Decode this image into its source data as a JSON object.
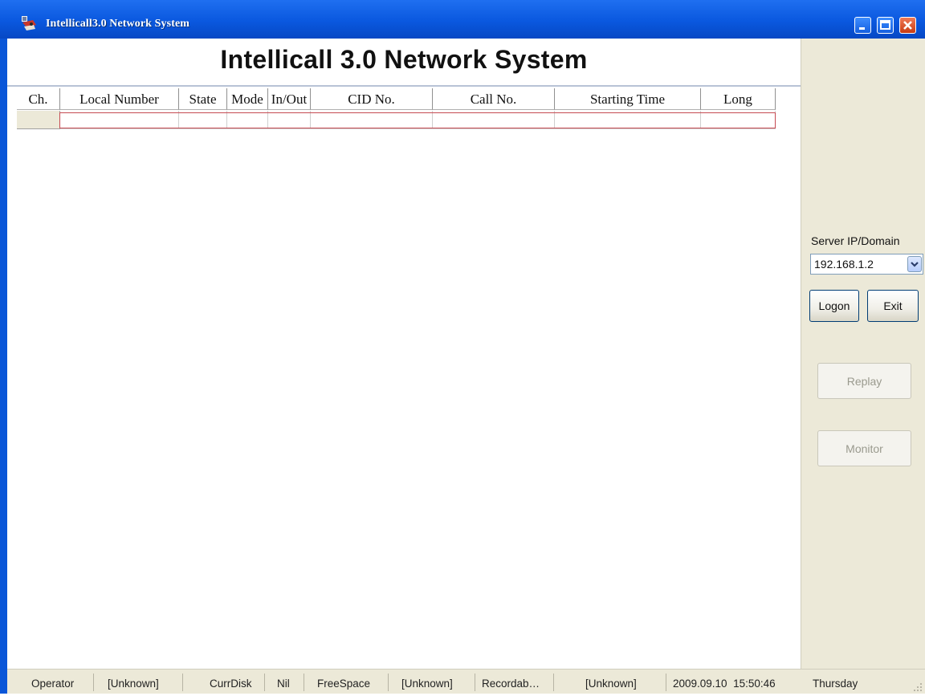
{
  "window": {
    "title": "Intellicall3.0 Network System",
    "icons": [
      "app-icon",
      "minimize-icon",
      "maximize-icon",
      "close-icon"
    ]
  },
  "header": {
    "title": "Intellicall 3.0 Network System"
  },
  "table": {
    "columns": [
      "Ch.",
      "Local Number",
      "State",
      "Mode",
      "In/Out",
      "CID No.",
      "Call No.",
      "Starting Time",
      "Long"
    ],
    "rows": [
      [
        "",
        "",
        "",
        "",
        "",
        "",
        "",
        "",
        ""
      ]
    ]
  },
  "side_panel": {
    "server_label": "Server IP/Domain",
    "server_value": "192.168.1.2",
    "logon_label": "Logon",
    "exit_label": "Exit",
    "replay_label": "Replay",
    "monitor_label": "Monitor"
  },
  "statusbar": {
    "operator_label": "Operator",
    "operator_value": "[Unknown]",
    "currdisk_label": "CurrDisk",
    "currdisk_value": "Nil",
    "freespace_label": "FreeSpace",
    "freespace_value": "[Unknown]",
    "recordable_label": "Recordab…",
    "recordable_value": "[Unknown]",
    "datetime": "2009.09.10  15:50:46",
    "weekday": "Thursday"
  },
  "colors": {
    "titlebar": "#0a58df",
    "panel": "#ece9d8",
    "row_outline": "#c64a52"
  }
}
